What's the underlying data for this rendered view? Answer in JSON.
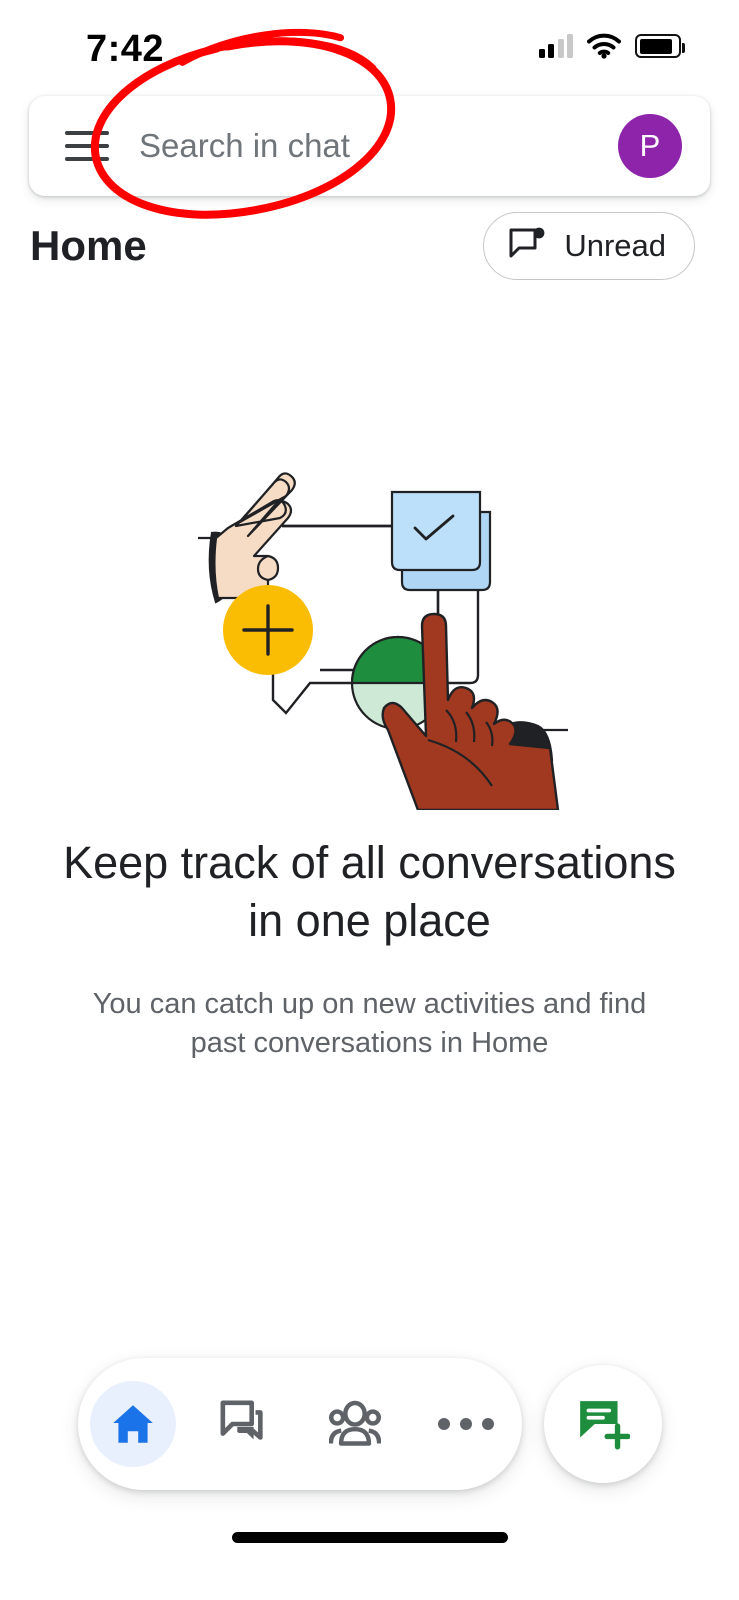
{
  "status_bar": {
    "time": "7:42",
    "signal_icon": "cellular-signal-icon",
    "wifi_icon": "wifi-icon",
    "battery_icon": "battery-icon"
  },
  "search": {
    "menu_icon": "hamburger-menu-icon",
    "placeholder": "Search in chat",
    "value": "",
    "avatar_initial": "P",
    "avatar_color": "#8E24AA"
  },
  "header": {
    "title": "Home",
    "unread_label": "Unread",
    "unread_icon": "unread-chat-bubble-icon"
  },
  "empty_state": {
    "illustration": "hands-chat-bubbles-illustration",
    "title": "Keep track of all conversations in one place",
    "subtitle": "You can catch up on new activities and find past conversations in Home"
  },
  "bottom_nav": {
    "items": [
      {
        "name": "home",
        "icon": "home-icon",
        "active": true
      },
      {
        "name": "chat",
        "icon": "chat-bubbles-icon",
        "active": false
      },
      {
        "name": "spaces",
        "icon": "people-group-icon",
        "active": false
      },
      {
        "name": "more",
        "icon": "more-horizontal-icon",
        "active": false
      }
    ],
    "fab_icon": "new-chat-compose-icon",
    "active_color": "#1A73E8",
    "active_pill_color": "#E8F0FE",
    "inactive_color": "#5F6368",
    "fab_color": "#1E8E3E"
  },
  "annotation": {
    "shape": "hand-drawn-ellipse",
    "color": "#FF0000",
    "target": "search-input"
  },
  "colors": {
    "background": "#FFFFFF",
    "text_primary": "#202124",
    "text_secondary": "#5F6368",
    "illustration_orange": "#FBBC04",
    "illustration_green": "#1E8E3E",
    "illustration_green_light": "#CEEAD6",
    "illustration_blue": "#AFD7F5",
    "illustration_skin_light": "#F6DCC4",
    "illustration_skin_dark": "#A0391F"
  }
}
